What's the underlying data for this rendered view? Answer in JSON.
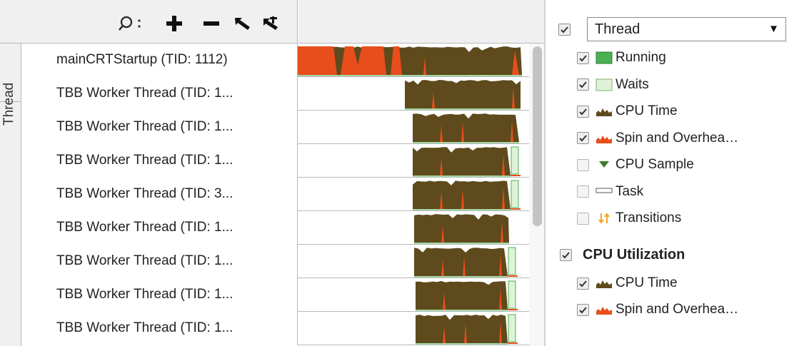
{
  "toolbar": {
    "search_icon": "search-icon",
    "menu_icon": "more-options-icon",
    "zoom_in_icon": "zoom-in-icon",
    "zoom_out_icon": "zoom-out-icon",
    "undo_zoom_icon": "undo-zoom-icon",
    "reset_zoom_icon": "reset-zoom-icon"
  },
  "timeline": {
    "group_label": "Thread",
    "rows": [
      {
        "label": "mainCRTStartup (TID: 1112)"
      },
      {
        "label": "TBB Worker Thread (TID: 1..."
      },
      {
        "label": "TBB Worker Thread (TID: 1..."
      },
      {
        "label": "TBB Worker Thread (TID: 1..."
      },
      {
        "label": "TBB Worker Thread (TID: 3..."
      },
      {
        "label": "TBB Worker Thread (TID: 1..."
      },
      {
        "label": "TBB Worker Thread (TID: 1..."
      },
      {
        "label": "TBB Worker Thread (TID: 1..."
      },
      {
        "label": "TBB Worker Thread (TID: 1..."
      }
    ]
  },
  "legend": {
    "thread_group": {
      "checked": true,
      "selected": "Thread"
    },
    "thread_items": [
      {
        "label": "Running",
        "checked": true,
        "icon": "running-swatch-icon"
      },
      {
        "label": "Waits",
        "checked": true,
        "icon": "waits-swatch-icon"
      },
      {
        "label": "CPU Time",
        "checked": true,
        "icon": "cpu-time-icon"
      },
      {
        "label": "Spin and Overhea…",
        "checked": true,
        "icon": "spin-overhead-icon"
      },
      {
        "label": "CPU Sample",
        "checked": false,
        "icon": "cpu-sample-icon"
      },
      {
        "label": "Task",
        "checked": false,
        "icon": "task-icon"
      },
      {
        "label": "Transitions",
        "checked": false,
        "icon": "transitions-icon"
      }
    ],
    "cpu_group": {
      "label": "CPU Utilization",
      "checked": true
    },
    "cpu_items": [
      {
        "label": "CPU Time",
        "checked": true,
        "icon": "cpu-time-icon"
      },
      {
        "label": "Spin and Overhea…",
        "checked": true,
        "icon": "spin-overhead-icon"
      }
    ]
  },
  "colors": {
    "cpu_time": "#5e4a1c",
    "spin_overhead": "#e84e1b",
    "running": "#4caf50",
    "waits": "#dff2d8",
    "cpu_sample": "#3f7a2c",
    "transitions": "#f5a623"
  }
}
